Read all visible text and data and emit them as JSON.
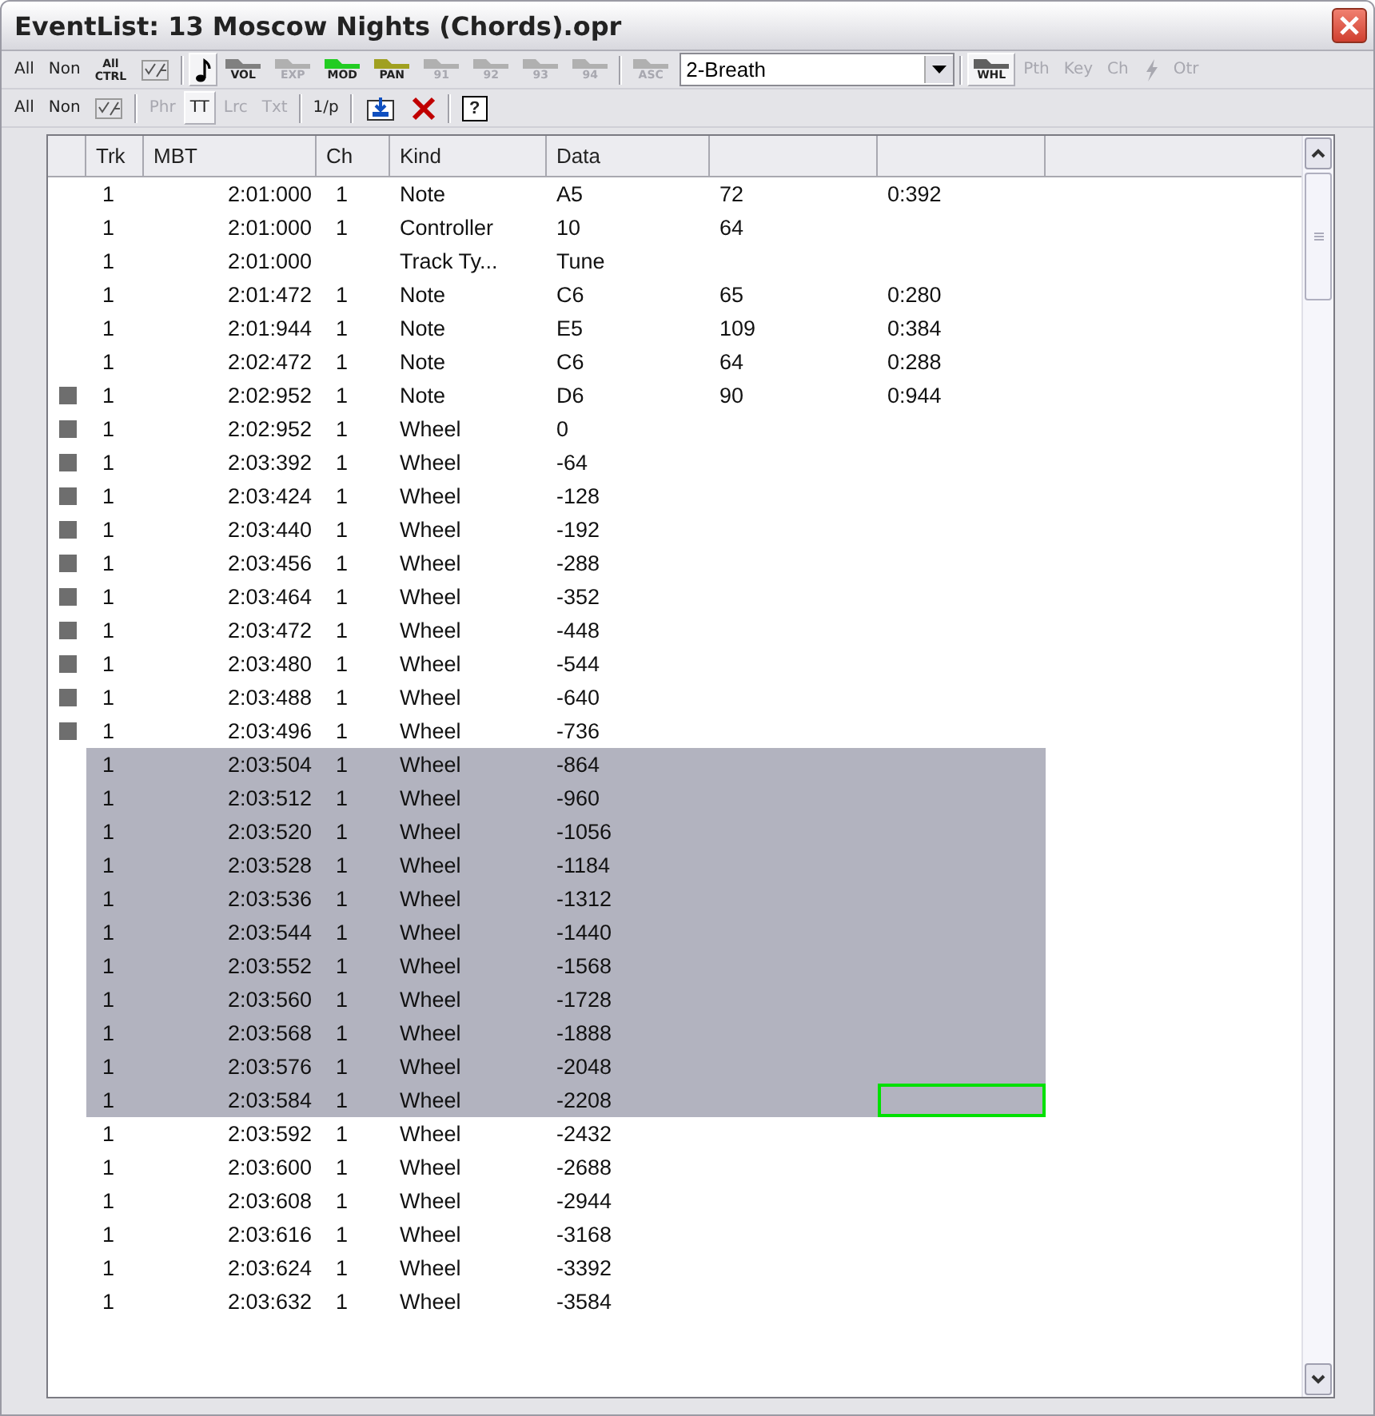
{
  "window": {
    "title": "EventList: 13 Moscow Nights (Chords).opr"
  },
  "toolbar_1": [
    {
      "kind": "text",
      "label": "All",
      "disabled": false,
      "selected": false
    },
    {
      "kind": "text",
      "label": "Non",
      "disabled": false,
      "selected": false
    },
    {
      "kind": "stacked",
      "label": "All",
      "sublabel": "CTRL",
      "disabled": false,
      "selected": false
    },
    {
      "kind": "check"
    },
    {
      "kind": "separator"
    },
    {
      "kind": "note",
      "selected": true
    },
    {
      "kind": "ramp",
      "label": "VOL",
      "color": "#808080",
      "disabled": false,
      "selected": false
    },
    {
      "kind": "ramp",
      "label": "EXP",
      "color": "#b0b0b0",
      "disabled": true,
      "selected": false
    },
    {
      "kind": "ramp",
      "label": "MOD",
      "color": "#22cc22",
      "disabled": false,
      "selected": false
    },
    {
      "kind": "ramp",
      "label": "PAN",
      "color": "#a0a020",
      "disabled": false,
      "selected": false
    },
    {
      "kind": "ramp",
      "label": "91",
      "color": "#b0b0b0",
      "disabled": true,
      "selected": false
    },
    {
      "kind": "ramp",
      "label": "92",
      "color": "#b0b0b0",
      "disabled": true,
      "selected": false
    },
    {
      "kind": "ramp",
      "label": "93",
      "color": "#b0b0b0",
      "disabled": true,
      "selected": false
    },
    {
      "kind": "ramp",
      "label": "94",
      "color": "#b0b0b0",
      "disabled": true,
      "selected": false
    },
    {
      "kind": "separator"
    },
    {
      "kind": "ramp",
      "label": "ASC",
      "color": "#b0b0b0",
      "disabled": true,
      "selected": false
    },
    {
      "kind": "dropdown",
      "value": "2-Breath"
    },
    {
      "kind": "separator"
    },
    {
      "kind": "ramp",
      "label": "WHL",
      "color": "#606060",
      "disabled": false,
      "selected": true
    },
    {
      "kind": "text",
      "label": "Pth",
      "disabled": true,
      "selected": false
    },
    {
      "kind": "text",
      "label": "Key",
      "disabled": true,
      "selected": false
    },
    {
      "kind": "text",
      "label": "Ch",
      "disabled": true,
      "selected": false
    },
    {
      "kind": "lightning",
      "disabled": true
    },
    {
      "kind": "text",
      "label": "Otr",
      "disabled": true,
      "selected": false
    }
  ],
  "toolbar_2": [
    {
      "kind": "text",
      "label": "All",
      "disabled": false,
      "selected": false
    },
    {
      "kind": "text",
      "label": "Non",
      "disabled": false,
      "selected": false
    },
    {
      "kind": "check"
    },
    {
      "kind": "separator"
    },
    {
      "kind": "text",
      "label": "Phr",
      "disabled": true,
      "selected": false
    },
    {
      "kind": "text",
      "label": "TT",
      "disabled": false,
      "selected": true
    },
    {
      "kind": "text",
      "label": "Lrc",
      "disabled": true,
      "selected": false
    },
    {
      "kind": "text",
      "label": "Txt",
      "disabled": true,
      "selected": false
    },
    {
      "kind": "separator"
    },
    {
      "kind": "text",
      "label": "1/p",
      "disabled": false,
      "selected": false
    },
    {
      "kind": "separator"
    },
    {
      "kind": "import"
    },
    {
      "kind": "delete"
    },
    {
      "kind": "separator"
    },
    {
      "kind": "help",
      "label": "?"
    }
  ],
  "table": {
    "columns": [
      "Trk",
      "MBT",
      "Ch",
      "Kind",
      "Data"
    ],
    "rows": [
      {
        "trk": "1",
        "mbt": "2:01:000",
        "ch": "1",
        "kind": "Note",
        "data": "A5",
        "column_6": "72",
        "column_7": "0:392",
        "marked": false,
        "selected": false,
        "focused": false
      },
      {
        "trk": "1",
        "mbt": "2:01:000",
        "ch": "1",
        "kind": "Controller",
        "data": "10",
        "column_6": "64",
        "marked": false,
        "selected": false,
        "focused": false
      },
      {
        "trk": "1",
        "mbt": "2:01:000",
        "kind": "Track Ty...",
        "data": "Tune",
        "marked": false,
        "selected": false,
        "focused": false
      },
      {
        "trk": "1",
        "mbt": "2:01:472",
        "ch": "1",
        "kind": "Note",
        "data": "C6",
        "column_6": "65",
        "column_7": "0:280",
        "marked": false,
        "selected": false,
        "focused": false
      },
      {
        "trk": "1",
        "mbt": "2:01:944",
        "ch": "1",
        "kind": "Note",
        "data": "E5",
        "column_6": "109",
        "column_7": "0:384",
        "marked": false,
        "selected": false,
        "focused": false
      },
      {
        "trk": "1",
        "mbt": "2:02:472",
        "ch": "1",
        "kind": "Note",
        "data": "C6",
        "column_6": "64",
        "column_7": "0:288",
        "marked": false,
        "selected": false,
        "focused": false
      },
      {
        "trk": "1",
        "mbt": "2:02:952",
        "ch": "1",
        "kind": "Note",
        "data": "D6",
        "column_6": "90",
        "column_7": "0:944",
        "marked": true,
        "selected": false,
        "focused": false
      },
      {
        "trk": "1",
        "mbt": "2:02:952",
        "ch": "1",
        "kind": "Wheel",
        "data": "0",
        "marked": true,
        "selected": false,
        "focused": false
      },
      {
        "trk": "1",
        "mbt": "2:03:392",
        "ch": "1",
        "kind": "Wheel",
        "data": "-64",
        "marked": true,
        "selected": false,
        "focused": false
      },
      {
        "trk": "1",
        "mbt": "2:03:424",
        "ch": "1",
        "kind": "Wheel",
        "data": "-128",
        "marked": true,
        "selected": false,
        "focused": false
      },
      {
        "trk": "1",
        "mbt": "2:03:440",
        "ch": "1",
        "kind": "Wheel",
        "data": "-192",
        "marked": true,
        "selected": false,
        "focused": false
      },
      {
        "trk": "1",
        "mbt": "2:03:456",
        "ch": "1",
        "kind": "Wheel",
        "data": "-288",
        "marked": true,
        "selected": false,
        "focused": false
      },
      {
        "trk": "1",
        "mbt": "2:03:464",
        "ch": "1",
        "kind": "Wheel",
        "data": "-352",
        "marked": true,
        "selected": false,
        "focused": false
      },
      {
        "trk": "1",
        "mbt": "2:03:472",
        "ch": "1",
        "kind": "Wheel",
        "data": "-448",
        "marked": true,
        "selected": false,
        "focused": false
      },
      {
        "trk": "1",
        "mbt": "2:03:480",
        "ch": "1",
        "kind": "Wheel",
        "data": "-544",
        "marked": true,
        "selected": false,
        "focused": false
      },
      {
        "trk": "1",
        "mbt": "2:03:488",
        "ch": "1",
        "kind": "Wheel",
        "data": "-640",
        "marked": true,
        "selected": false,
        "focused": false
      },
      {
        "trk": "1",
        "mbt": "2:03:496",
        "ch": "1",
        "kind": "Wheel",
        "data": "-736",
        "marked": true,
        "selected": false,
        "focused": false
      },
      {
        "trk": "1",
        "mbt": "2:03:504",
        "ch": "1",
        "kind": "Wheel",
        "data": "-864",
        "marked": false,
        "selected": true,
        "focused": false
      },
      {
        "trk": "1",
        "mbt": "2:03:512",
        "ch": "1",
        "kind": "Wheel",
        "data": "-960",
        "marked": false,
        "selected": true,
        "focused": false
      },
      {
        "trk": "1",
        "mbt": "2:03:520",
        "ch": "1",
        "kind": "Wheel",
        "data": "-1056",
        "marked": false,
        "selected": true,
        "focused": false
      },
      {
        "trk": "1",
        "mbt": "2:03:528",
        "ch": "1",
        "kind": "Wheel",
        "data": "-1184",
        "marked": false,
        "selected": true,
        "focused": false
      },
      {
        "trk": "1",
        "mbt": "2:03:536",
        "ch": "1",
        "kind": "Wheel",
        "data": "-1312",
        "marked": false,
        "selected": true,
        "focused": false
      },
      {
        "trk": "1",
        "mbt": "2:03:544",
        "ch": "1",
        "kind": "Wheel",
        "data": "-1440",
        "marked": false,
        "selected": true,
        "focused": false
      },
      {
        "trk": "1",
        "mbt": "2:03:552",
        "ch": "1",
        "kind": "Wheel",
        "data": "-1568",
        "marked": false,
        "selected": true,
        "focused": false
      },
      {
        "trk": "1",
        "mbt": "2:03:560",
        "ch": "1",
        "kind": "Wheel",
        "data": "-1728",
        "marked": false,
        "selected": true,
        "focused": false
      },
      {
        "trk": "1",
        "mbt": "2:03:568",
        "ch": "1",
        "kind": "Wheel",
        "data": "-1888",
        "marked": false,
        "selected": true,
        "focused": false
      },
      {
        "trk": "1",
        "mbt": "2:03:576",
        "ch": "1",
        "kind": "Wheel",
        "data": "-2048",
        "marked": false,
        "selected": true,
        "focused": false
      },
      {
        "trk": "1",
        "mbt": "2:03:584",
        "ch": "1",
        "kind": "Wheel",
        "data": "-2208",
        "marked": false,
        "selected": true,
        "focused": true
      },
      {
        "trk": "1",
        "mbt": "2:03:592",
        "ch": "1",
        "kind": "Wheel",
        "data": "-2432",
        "marked": false,
        "selected": false,
        "focused": false
      },
      {
        "trk": "1",
        "mbt": "2:03:600",
        "ch": "1",
        "kind": "Wheel",
        "data": "-2688",
        "marked": false,
        "selected": false,
        "focused": false
      },
      {
        "trk": "1",
        "mbt": "2:03:608",
        "ch": "1",
        "kind": "Wheel",
        "data": "-2944",
        "marked": false,
        "selected": false,
        "focused": false
      },
      {
        "trk": "1",
        "mbt": "2:03:616",
        "ch": "1",
        "kind": "Wheel",
        "data": "-3168",
        "marked": false,
        "selected": false,
        "focused": false
      },
      {
        "trk": "1",
        "mbt": "2:03:624",
        "ch": "1",
        "kind": "Wheel",
        "data": "-3392",
        "marked": false,
        "selected": false,
        "focused": false
      },
      {
        "trk": "1",
        "mbt": "2:03:632",
        "ch": "1",
        "kind": "Wheel",
        "data": "-3584",
        "marked": false,
        "selected": false,
        "focused": false
      }
    ]
  }
}
